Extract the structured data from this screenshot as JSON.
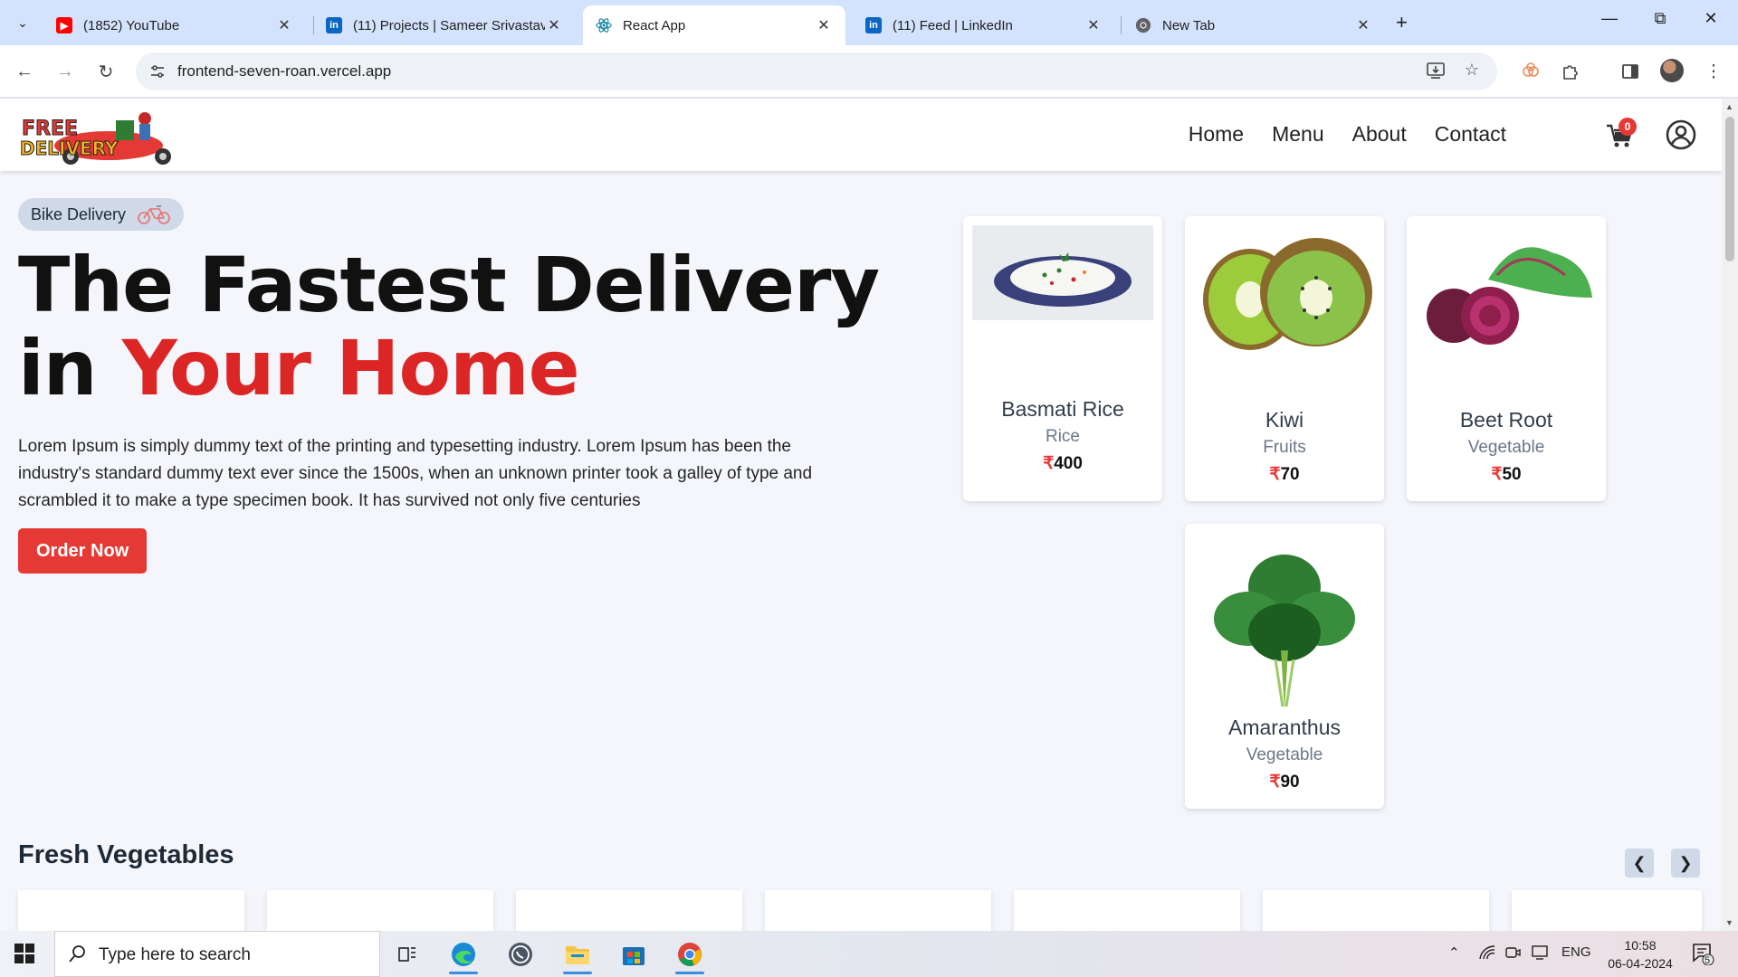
{
  "browser": {
    "tabs": [
      {
        "title": "(1852) YouTube",
        "icon": "youtube-icon",
        "active": false
      },
      {
        "title": "(11) Projects | Sameer Srivastav",
        "icon": "linkedin-icon",
        "active": false
      },
      {
        "title": "React App",
        "icon": "react-icon",
        "active": true
      },
      {
        "title": "(11) Feed | LinkedIn",
        "icon": "linkedin-icon",
        "active": false
      },
      {
        "title": "New Tab",
        "icon": "chrome-icon",
        "active": false
      }
    ],
    "url": "frontend-seven-roan.vercel.app"
  },
  "site": {
    "logo_text": "FREE DELIVERY",
    "nav": [
      "Home",
      "Menu",
      "About",
      "Contact"
    ],
    "cart_count": "0",
    "hero": {
      "pill_label": "Bike Delivery",
      "title_line1": "The Fastest Delivery",
      "title_in": "in",
      "title_highlight": "Your Home",
      "description": "Lorem Ipsum is simply dummy text of the printing and typesetting industry. Lorem Ipsum has been the industry's standard dummy text ever since the 1500s, when an unknown printer took a galley of type and scrambled it to make a type specimen book. It has survived not only five centuries",
      "cta": "Order Now"
    },
    "featured": [
      {
        "name": "Basmati Rice",
        "category": "Rice",
        "price": "400",
        "image": "rice-plate"
      },
      {
        "name": "Kiwi",
        "category": "Fruits",
        "price": "70",
        "image": "kiwi"
      },
      {
        "name": "Beet Root",
        "category": "Vegetable",
        "price": "50",
        "image": "beetroot"
      },
      {
        "name": "Amaranthus",
        "category": "Vegetable",
        "price": "90",
        "image": "leafy-greens"
      }
    ],
    "currency_symbol": "₹",
    "section_title": "Fresh Vegetables"
  },
  "taskbar": {
    "search_placeholder": "Type here to search",
    "language": "ENG",
    "time": "10:58",
    "date": "06-04-2024",
    "notification_count": "5"
  },
  "colors": {
    "accent_red": "#e53935",
    "headline_red": "#dc2626",
    "tabstrip": "#d3e3fd"
  }
}
